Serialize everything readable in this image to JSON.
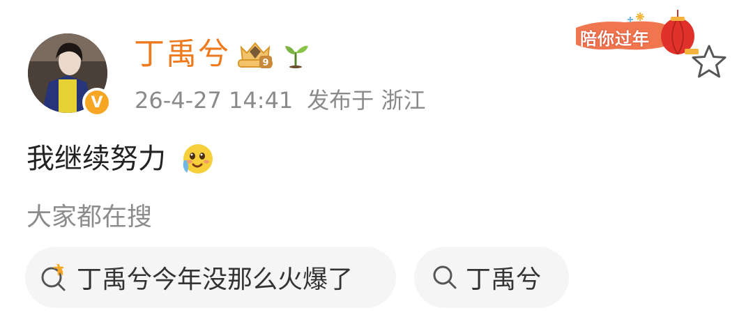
{
  "post": {
    "username": "丁禹兮",
    "verified_badge": "V",
    "timestamp": "26-4-27 14:41",
    "location": "发布于 浙江",
    "content": "我继续努力",
    "festival_label": "陪你过年",
    "icons": [
      "crown-level-icon",
      "sprout-icon",
      "lantern-icon",
      "star-icon",
      "crying-emoji-icon"
    ]
  },
  "trending": {
    "title": "大家都在搜",
    "items": [
      {
        "label": "丁禹兮今年没那么火爆了",
        "icon": "hot-search-icon"
      },
      {
        "label": "丁禹兮",
        "icon": "search-icon"
      }
    ]
  },
  "colors": {
    "username": "#ef7a1e",
    "meta": "#8a8a8a",
    "chip_bg": "#f5f5f5",
    "hot": "#f6a623"
  }
}
